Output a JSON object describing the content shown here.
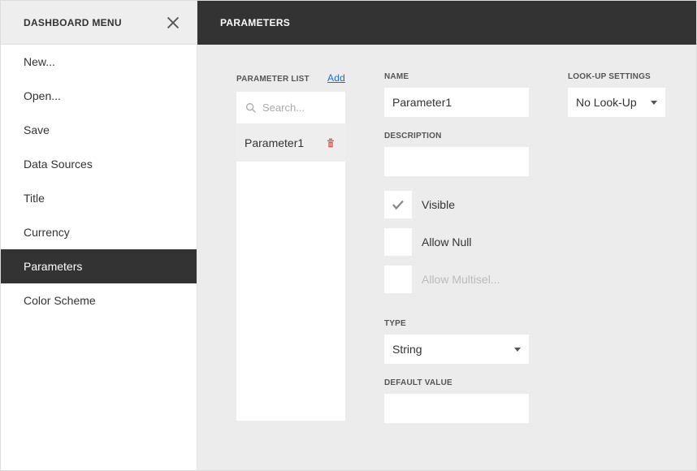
{
  "sidebar": {
    "title": "DASHBOARD MENU",
    "items": [
      {
        "label": "New..."
      },
      {
        "label": "Open..."
      },
      {
        "label": "Save"
      },
      {
        "label": "Data Sources"
      },
      {
        "label": "Title"
      },
      {
        "label": "Currency"
      },
      {
        "label": "Parameters"
      },
      {
        "label": "Color Scheme"
      }
    ],
    "active_index": 6
  },
  "header": {
    "title": "PARAMETERS"
  },
  "parameter_list": {
    "label": "PARAMETER LIST",
    "add_label": "Add",
    "search_placeholder": "Search...",
    "items": [
      {
        "name": "Parameter1"
      }
    ]
  },
  "properties": {
    "name_label": "NAME",
    "name_value": "Parameter1",
    "description_label": "DESCRIPTION",
    "description_value": "",
    "visible_label": "Visible",
    "visible_checked": true,
    "allow_null_label": "Allow Null",
    "allow_null_checked": false,
    "allow_multiselect_label": "Allow Multisel...",
    "allow_multiselect_checked": false,
    "allow_multiselect_disabled": true,
    "type_label": "TYPE",
    "type_value": "String",
    "default_value_label": "DEFAULT VALUE",
    "default_value": ""
  },
  "lookup": {
    "label": "LOOK-UP SETTINGS",
    "value": "No Look-Up"
  }
}
